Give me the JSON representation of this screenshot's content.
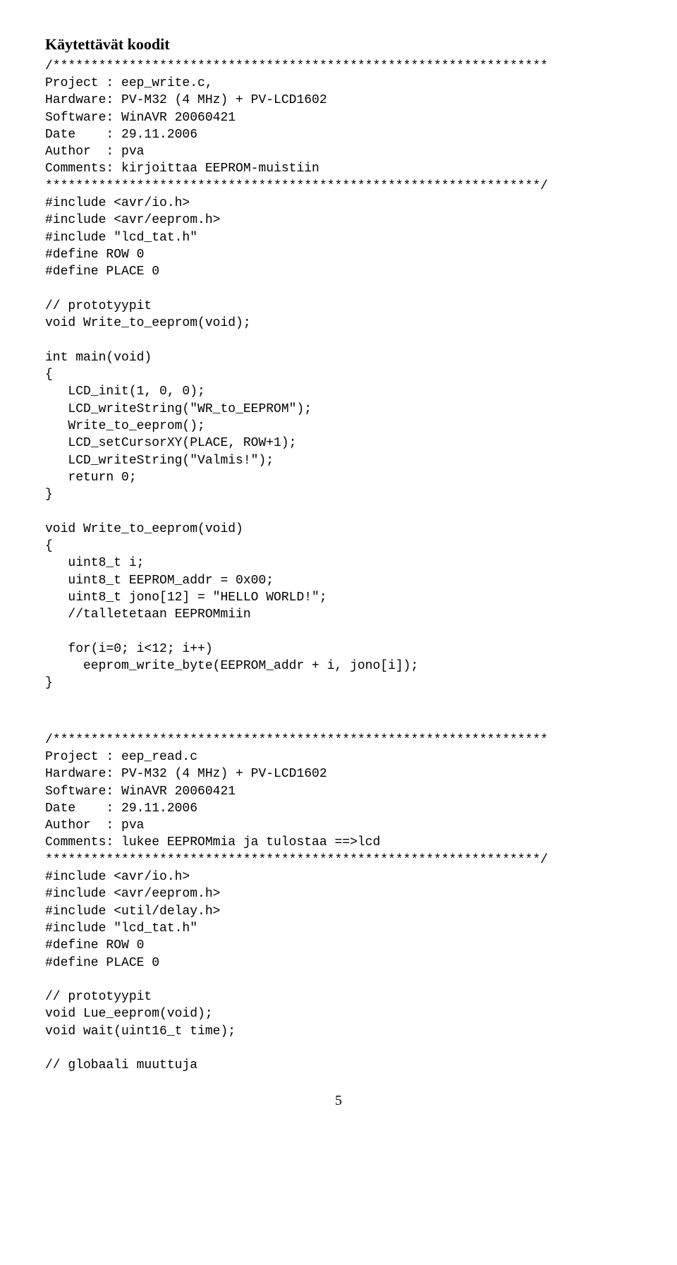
{
  "heading": "Käytettävät koodit",
  "block1": {
    "l1": "/*****************************************************************",
    "l2": "Project : eep_write.c,",
    "l3": "Hardware: PV-M32 (4 MHz) + PV-LCD1602",
    "l4": "Software: WinAVR 20060421",
    "l5": "Date    : 29.11.2006",
    "l6": "Author  : pva",
    "l7": "Comments: kirjoittaa EEPROM-muistiin",
    "l8": "*****************************************************************/",
    "l9": "#include <avr/io.h>",
    "l10": "#include <avr/eeprom.h>",
    "l11": "#include \"lcd_tat.h\"",
    "l12": "#define ROW 0",
    "l13": "#define PLACE 0",
    "l14": "// prototyypit",
    "l15": "void Write_to_eeprom(void);",
    "l16": "int main(void)",
    "l17": "{",
    "l18": "   LCD_init(1, 0, 0);",
    "l19": "   LCD_writeString(\"WR_to_EEPROM\");",
    "l20": "   Write_to_eeprom();",
    "l21": "   LCD_setCursorXY(PLACE, ROW+1);",
    "l22": "   LCD_writeString(\"Valmis!\");",
    "l23": "   return 0;",
    "l24": "}",
    "l25": "void Write_to_eeprom(void)",
    "l26": "{",
    "l27": "   uint8_t i;",
    "l28": "   uint8_t EEPROM_addr = 0x00;",
    "l29": "   uint8_t jono[12] = \"HELLO WORLD!\";",
    "l30": "   //talletetaan EEPROMmiin",
    "l31": "   for(i=0; i<12; i++)",
    "l32": "     eeprom_write_byte(EEPROM_addr + i, jono[i]);",
    "l33": "}"
  },
  "block2": {
    "l1": "/*****************************************************************",
    "l2": "Project : eep_read.c",
    "l3": "Hardware: PV-M32 (4 MHz) + PV-LCD1602",
    "l4": "Software: WinAVR 20060421",
    "l5": "Date    : 29.11.2006",
    "l6": "Author  : pva",
    "l7": "Comments: lukee EEPROMmia ja tulostaa ==>lcd",
    "l8": "*****************************************************************/",
    "l9": "#include <avr/io.h>",
    "l10": "#include <avr/eeprom.h>",
    "l11": "#include <util/delay.h>",
    "l12": "#include \"lcd_tat.h\"",
    "l13": "#define ROW 0",
    "l14": "#define PLACE 0",
    "l15": "// prototyypit",
    "l16": "void Lue_eeprom(void);",
    "l17": "void wait(uint16_t time);",
    "l18": "// globaali muuttuja"
  },
  "page_number": "5"
}
